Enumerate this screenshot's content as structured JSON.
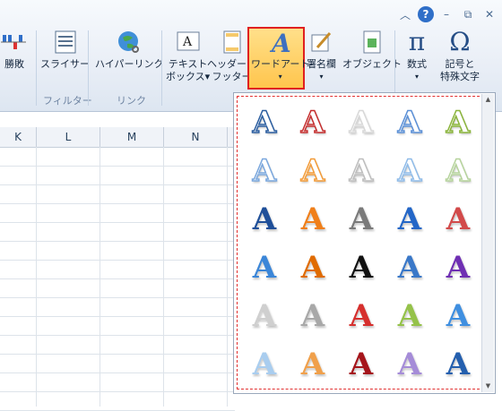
{
  "ribbon": {
    "buttons": [
      {
        "id": "win-loss",
        "label": "勝敗",
        "x_hint": ""
      },
      {
        "id": "slicer",
        "label": "スライサー"
      },
      {
        "id": "hyperlink",
        "label": "ハイパーリンク"
      },
      {
        "id": "textbox",
        "label1": "テキスト",
        "label2": "ボックス▾"
      },
      {
        "id": "headerfooter",
        "label1": "ヘッダーと",
        "label2": "フッター"
      },
      {
        "id": "wordart",
        "label1": "ワードアート",
        "label2": "▾"
      },
      {
        "id": "signature",
        "label1": "署名欄",
        "label2": "▾"
      },
      {
        "id": "object",
        "label": "オブジェクト"
      },
      {
        "id": "equation",
        "label1": "数式",
        "label2": "▾"
      },
      {
        "id": "symbol",
        "label1": "記号と",
        "label2": "特殊文字"
      }
    ],
    "groups": {
      "filter": "フィルター",
      "link": "リンク"
    }
  },
  "columns": [
    "K",
    "L",
    "M",
    "N"
  ],
  "gallery": {
    "glyph": "A",
    "rows": [
      [
        "#2a5d9f",
        "#c42d2d",
        "#d8d8d8",
        "#5a8fd6",
        "#8ab43b"
      ],
      [
        "#7aa7dd",
        "#f29b38",
        "#bdbdbd",
        "#8fbbe8",
        "#b6d39c"
      ],
      [
        "#1f4f99",
        "#f07f1a",
        "#7a7a7a",
        "#2366c7",
        "#d24a4a"
      ],
      [
        "#3b86d8",
        "#e06b00",
        "#111111",
        "#3a78c8",
        "#6f2fb3"
      ],
      [
        "#cfcfcf",
        "#a8a8a8",
        "#d6302e",
        "#95c24a",
        "#3f8fe0"
      ],
      [
        "#a9cdef",
        "#f0a04b",
        "#a5151b",
        "#a58cd8",
        "#245fae"
      ]
    ]
  },
  "window": {
    "help": "?"
  }
}
